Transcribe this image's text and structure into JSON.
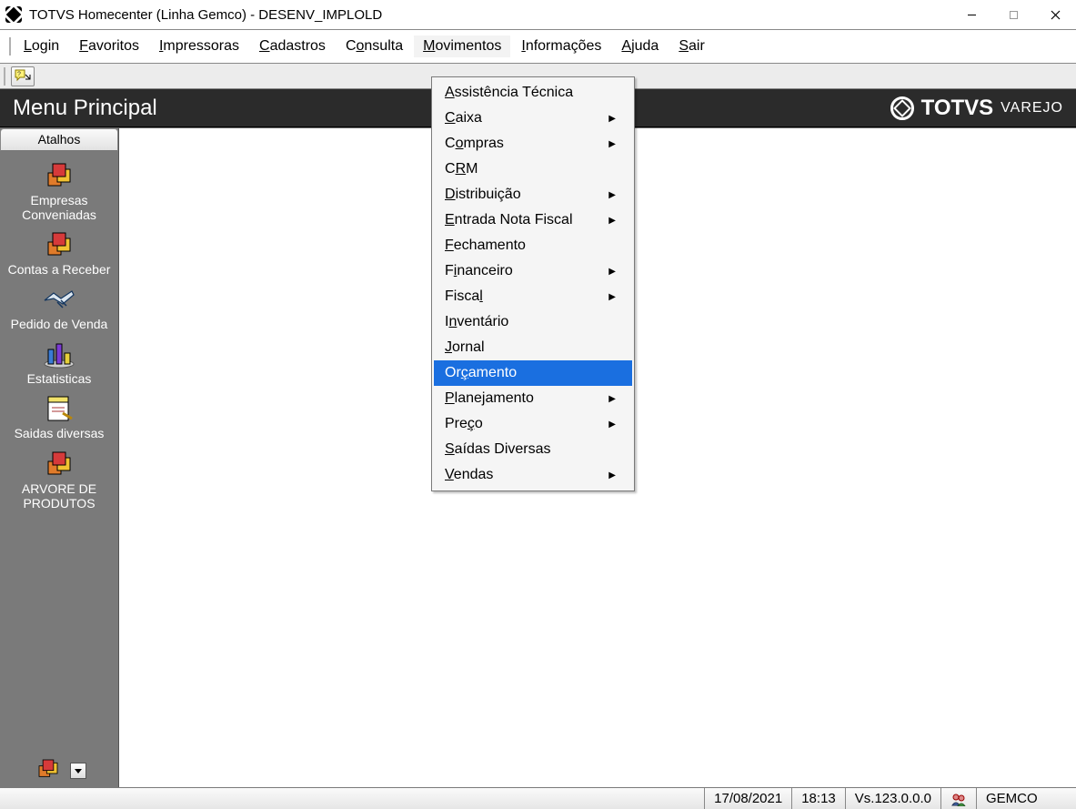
{
  "window": {
    "title": "TOTVS Homecenter (Linha Gemco) - DESENV_IMPLOLD"
  },
  "menubar": {
    "items": [
      {
        "label": "Login",
        "underline_index": 0
      },
      {
        "label": "Favoritos",
        "underline_index": 0
      },
      {
        "label": "Impressoras",
        "underline_index": 0
      },
      {
        "label": "Cadastros",
        "underline_index": 0
      },
      {
        "label": "Consulta",
        "underline_index": 1
      },
      {
        "label": "Movimentos",
        "underline_index": 0,
        "active": true
      },
      {
        "label": "Informações",
        "underline_index": 0
      },
      {
        "label": "Ajuda",
        "underline_index": 0
      },
      {
        "label": "Sair",
        "underline_index": 0
      }
    ]
  },
  "banner": {
    "title": "Menu Principal",
    "brand": "TOTVS",
    "brand_sub": "VAREJO"
  },
  "sidebar": {
    "tab_label": "Atalhos",
    "items": [
      {
        "label": "Empresas Conveniadas",
        "icon": "boxes"
      },
      {
        "label": "Contas a Receber",
        "icon": "boxes"
      },
      {
        "label": "Pedido de Venda",
        "icon": "handshake"
      },
      {
        "label": "Estatisticas",
        "icon": "chart"
      },
      {
        "label": "Saidas diversas",
        "icon": "document"
      },
      {
        "label": "ARVORE DE PRODUTOS",
        "icon": "boxes"
      }
    ]
  },
  "dropdown": {
    "items": [
      {
        "label": "Assistência Técnica",
        "underline_index": 0,
        "submenu": false
      },
      {
        "label": "Caixa",
        "underline_index": 0,
        "submenu": true
      },
      {
        "label": "Compras",
        "underline_index": 1,
        "submenu": true
      },
      {
        "label": "CRM",
        "underline_index": 1,
        "submenu": false
      },
      {
        "label": "Distribuição",
        "underline_index": 0,
        "submenu": true
      },
      {
        "label": "Entrada Nota Fiscal",
        "underline_index": 0,
        "submenu": true
      },
      {
        "label": "Fechamento",
        "underline_index": 0,
        "submenu": false
      },
      {
        "label": "Financeiro",
        "underline_index": 1,
        "submenu": true
      },
      {
        "label": "Fiscal",
        "underline_index": 5,
        "submenu": true
      },
      {
        "label": "Inventário",
        "underline_index": 1,
        "submenu": false
      },
      {
        "label": "Jornal",
        "underline_index": 0,
        "submenu": false
      },
      {
        "label": "Orçamento",
        "underline_index": 2,
        "submenu": false,
        "highlight": true
      },
      {
        "label": "Planejamento",
        "underline_index": 0,
        "submenu": true
      },
      {
        "label": "Preço ",
        "underline_index": 3,
        "submenu": true
      },
      {
        "label": "Saídas Diversas",
        "underline_index": 0,
        "submenu": false
      },
      {
        "label": "Vendas",
        "underline_index": 0,
        "submenu": true
      }
    ]
  },
  "statusbar": {
    "date": "17/08/2021",
    "time": "18:13",
    "version": "Vs.123.0.0.0",
    "user": "GEMCO"
  }
}
